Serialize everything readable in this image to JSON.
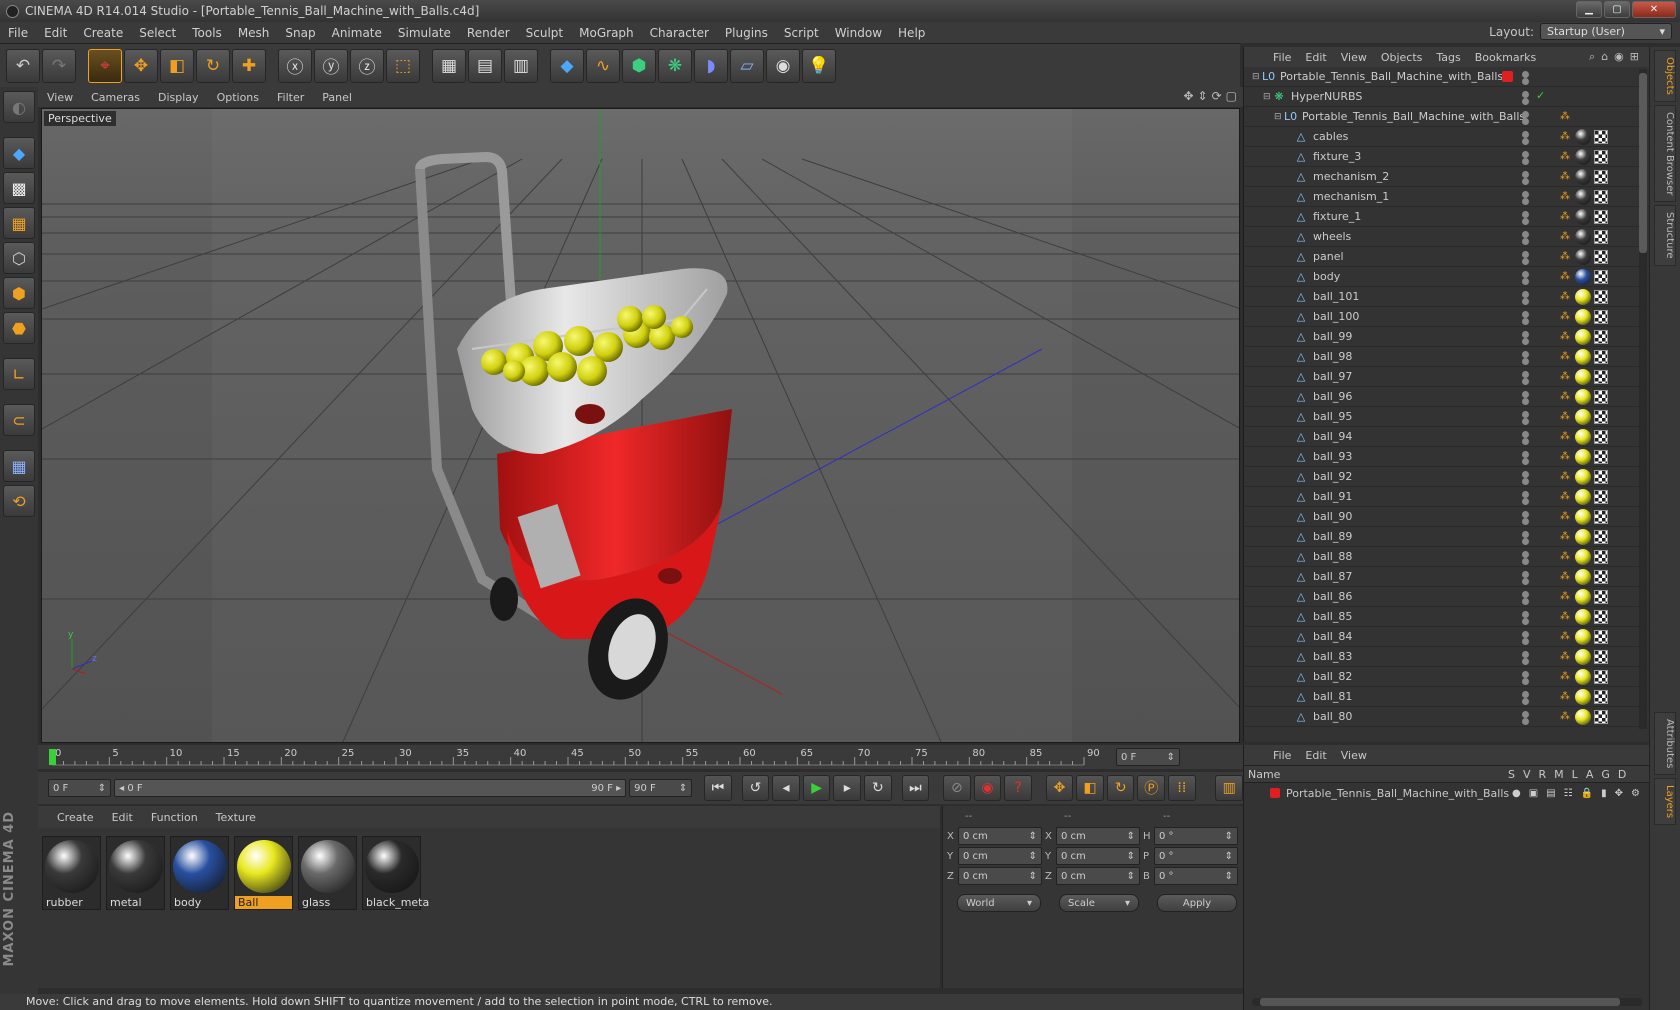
{
  "window": {
    "title": "CINEMA 4D R14.014 Studio - [Portable_Tennis_Ball_Machine_with_Balls.c4d]",
    "ctrl_min": "▁",
    "ctrl_max": "▢",
    "ctrl_close": "✕"
  },
  "menu": [
    "File",
    "Edit",
    "Create",
    "Select",
    "Tools",
    "Mesh",
    "Snap",
    "Animate",
    "Simulate",
    "Render",
    "Sculpt",
    "MoGraph",
    "Character",
    "Plugins",
    "Script",
    "Window",
    "Help"
  ],
  "layout": {
    "label": "Layout:",
    "value": "Startup (User)",
    "arrow": "▾"
  },
  "viewport": {
    "menu": [
      "View",
      "Cameras",
      "Display",
      "Options",
      "Filter",
      "Panel"
    ],
    "label": "Perspective",
    "axis_y": "y",
    "axis_z": "z"
  },
  "timeline": {
    "ticks": [
      "0",
      "5",
      "10",
      "15",
      "20",
      "25",
      "30",
      "35",
      "40",
      "45",
      "50",
      "55",
      "60",
      "65",
      "70",
      "75",
      "80",
      "85",
      "90"
    ],
    "frame": "0 F",
    "frame_arrow": "⇕"
  },
  "transport": {
    "start": "0 F",
    "range_left": "◂ 0 F",
    "range_right": "90 F ▸",
    "end_in": "90 F",
    "end": "90 F",
    "spin": "⇕"
  },
  "materials": {
    "menu": [
      "Create",
      "Edit",
      "Function",
      "Texture"
    ],
    "items": [
      {
        "name": "rubber",
        "color": "#3a3a3a"
      },
      {
        "name": "metal",
        "color": "#3a3a3a"
      },
      {
        "name": "body",
        "color": "#2850a0"
      },
      {
        "name": "Ball",
        "color": "#e8e820"
      },
      {
        "name": "glass",
        "color": "#6a6a6a"
      },
      {
        "name": "black_meta",
        "color": "#2a2a2a"
      }
    ]
  },
  "coords": {
    "headers": [
      "--",
      "--",
      "--"
    ],
    "rows": [
      {
        "a": "X",
        "av": "0 cm",
        "b": "X",
        "bv": "0 cm",
        "c": "H",
        "cv": "0 °"
      },
      {
        "a": "Y",
        "av": "0 cm",
        "b": "Y",
        "bv": "0 cm",
        "c": "P",
        "cv": "0 °"
      },
      {
        "a": "Z",
        "av": "0 cm",
        "b": "Z",
        "bv": "0 cm",
        "c": "B",
        "cv": "0 °"
      }
    ],
    "spin": "⇕",
    "space": "World",
    "mode": "Scale",
    "drop": "▾",
    "apply": "Apply"
  },
  "status": "Move: Click and drag to move elements. Hold down SHIFT to quantize movement / add to the selection in point mode, CTRL to remove.",
  "objects": {
    "menu": [
      "File",
      "Edit",
      "View",
      "Objects",
      "Tags",
      "Bookmarks"
    ],
    "items": [
      {
        "name": "Portable_Tennis_Ball_Machine_with_Balls",
        "depth": 0,
        "icon": "L0"
      },
      {
        "name": "HyperNURBS",
        "depth": 1,
        "icon": "❋"
      },
      {
        "name": "Portable_Tennis_Ball_Machine_with_Balls",
        "depth": 2,
        "icon": "L0"
      },
      {
        "name": "cables",
        "depth": 3,
        "icon": "△",
        "mat": "#3a3a3a"
      },
      {
        "name": "fixture_3",
        "depth": 3,
        "icon": "△",
        "mat": "#3a3a3a"
      },
      {
        "name": "mechanism_2",
        "depth": 3,
        "icon": "△",
        "mat": "#3a3a3a"
      },
      {
        "name": "mechanism_1",
        "depth": 3,
        "icon": "△",
        "mat": "#3a3a3a"
      },
      {
        "name": "fixture_1",
        "depth": 3,
        "icon": "△",
        "mat": "#3a3a3a"
      },
      {
        "name": "wheels",
        "depth": 3,
        "icon": "△",
        "mat": "#3a3a3a"
      },
      {
        "name": "panel",
        "depth": 3,
        "icon": "△",
        "mat": "#3a3a3a"
      },
      {
        "name": "body",
        "depth": 3,
        "icon": "△",
        "mat": "#2850a0"
      },
      {
        "name": "ball_101",
        "depth": 3,
        "icon": "△",
        "mat": "#e8e820"
      },
      {
        "name": "ball_100",
        "depth": 3,
        "icon": "△",
        "mat": "#e8e820"
      },
      {
        "name": "ball_99",
        "depth": 3,
        "icon": "△",
        "mat": "#e8e820"
      },
      {
        "name": "ball_98",
        "depth": 3,
        "icon": "△",
        "mat": "#e8e820"
      },
      {
        "name": "ball_97",
        "depth": 3,
        "icon": "△",
        "mat": "#e8e820"
      },
      {
        "name": "ball_96",
        "depth": 3,
        "icon": "△",
        "mat": "#e8e820"
      },
      {
        "name": "ball_95",
        "depth": 3,
        "icon": "△",
        "mat": "#e8e820"
      },
      {
        "name": "ball_94",
        "depth": 3,
        "icon": "△",
        "mat": "#e8e820"
      },
      {
        "name": "ball_93",
        "depth": 3,
        "icon": "△",
        "mat": "#e8e820"
      },
      {
        "name": "ball_92",
        "depth": 3,
        "icon": "△",
        "mat": "#e8e820"
      },
      {
        "name": "ball_91",
        "depth": 3,
        "icon": "△",
        "mat": "#e8e820"
      },
      {
        "name": "ball_90",
        "depth": 3,
        "icon": "△",
        "mat": "#e8e820"
      },
      {
        "name": "ball_89",
        "depth": 3,
        "icon": "△",
        "mat": "#e8e820"
      },
      {
        "name": "ball_88",
        "depth": 3,
        "icon": "△",
        "mat": "#e8e820"
      },
      {
        "name": "ball_87",
        "depth": 3,
        "icon": "△",
        "mat": "#e8e820"
      },
      {
        "name": "ball_86",
        "depth": 3,
        "icon": "△",
        "mat": "#e8e820"
      },
      {
        "name": "ball_85",
        "depth": 3,
        "icon": "△",
        "mat": "#e8e820"
      },
      {
        "name": "ball_84",
        "depth": 3,
        "icon": "△",
        "mat": "#e8e820"
      },
      {
        "name": "ball_83",
        "depth": 3,
        "icon": "△",
        "mat": "#e8e820"
      },
      {
        "name": "ball_82",
        "depth": 3,
        "icon": "△",
        "mat": "#e8e820"
      },
      {
        "name": "ball_81",
        "depth": 3,
        "icon": "△",
        "mat": "#e8e820"
      },
      {
        "name": "ball_80",
        "depth": 3,
        "icon": "△",
        "mat": "#e8e820"
      }
    ]
  },
  "side_tabs": [
    "Objects",
    "Content Browser",
    "Structure"
  ],
  "side_tabs2": [
    "Attributes",
    "Layers"
  ],
  "layers": {
    "menu": [
      "File",
      "Edit",
      "View"
    ],
    "name_col": "Name",
    "cols": [
      "S",
      "V",
      "R",
      "M",
      "L",
      "A",
      "G",
      "D"
    ],
    "row": "Portable_Tennis_Ball_Machine_with_Balls",
    "row_color": "#e02020"
  },
  "brand": "MAXON CINEMA 4D"
}
